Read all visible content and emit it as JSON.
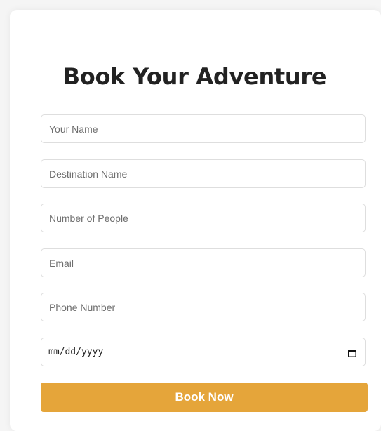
{
  "form": {
    "title": "Book Your Adventure",
    "fields": {
      "name_placeholder": "Your Name",
      "destination_placeholder": "Destination Name",
      "people_placeholder": "Number of People",
      "email_placeholder": "Email",
      "phone_placeholder": "Phone Number",
      "date_placeholder": "mm/dd/yyyy"
    },
    "submit_label": "Book Now"
  },
  "colors": {
    "accent": "#e5a53a",
    "title_text": "#222222",
    "field_border": "#dedede",
    "placeholder_text": "#6e6e6e"
  },
  "icons": {
    "date_picker": "calendar-icon"
  }
}
